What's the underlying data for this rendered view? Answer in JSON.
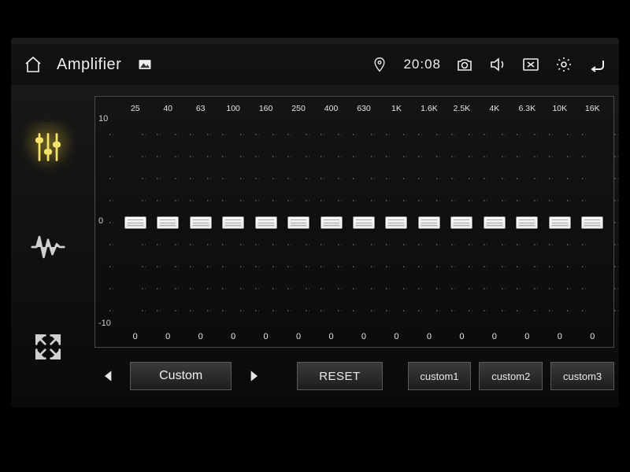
{
  "statusbar": {
    "title": "Amplifier",
    "time": "20:08"
  },
  "eq": {
    "scale": {
      "max": "10",
      "mid": "0",
      "min": "-10"
    },
    "bands": [
      {
        "freq": "25",
        "value": "0"
      },
      {
        "freq": "40",
        "value": "0"
      },
      {
        "freq": "63",
        "value": "0"
      },
      {
        "freq": "100",
        "value": "0"
      },
      {
        "freq": "160",
        "value": "0"
      },
      {
        "freq": "250",
        "value": "0"
      },
      {
        "freq": "400",
        "value": "0"
      },
      {
        "freq": "630",
        "value": "0"
      },
      {
        "freq": "1K",
        "value": "0"
      },
      {
        "freq": "1.6K",
        "value": "0"
      },
      {
        "freq": "2.5K",
        "value": "0"
      },
      {
        "freq": "4K",
        "value": "0"
      },
      {
        "freq": "6.3K",
        "value": "0"
      },
      {
        "freq": "10K",
        "value": "0"
      },
      {
        "freq": "16K",
        "value": "0"
      }
    ]
  },
  "controls": {
    "preset_current": "Custom",
    "reset_label": "RESET",
    "slots": [
      "custom1",
      "custom2",
      "custom3"
    ]
  }
}
